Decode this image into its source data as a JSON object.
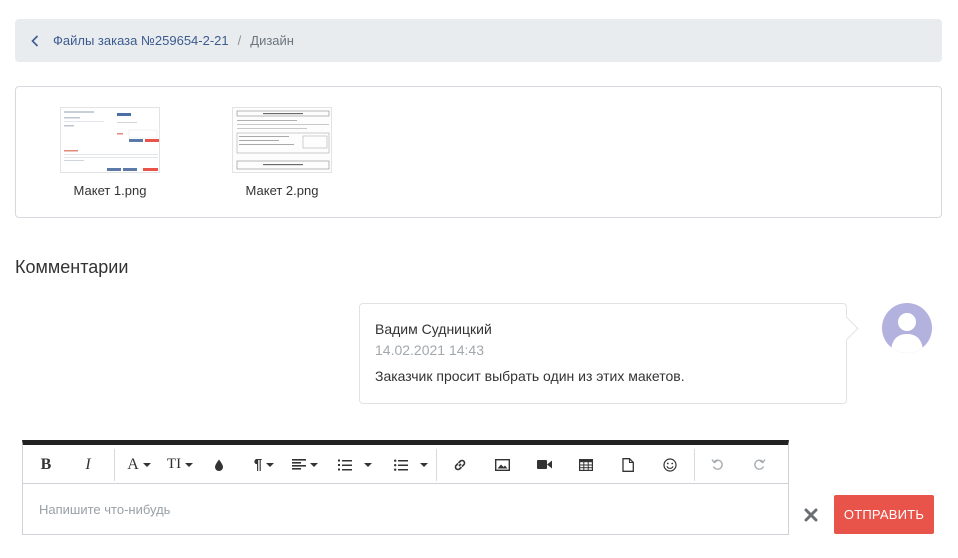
{
  "breadcrumb": {
    "back_icon": "chevron-left-icon",
    "parent_label": "Файлы заказа №259654-2-21",
    "separator": "/",
    "current_label": "Дизайн"
  },
  "files": [
    {
      "name": "Макет 1.png"
    },
    {
      "name": "Макет 2.png"
    }
  ],
  "comments_section": {
    "title": "Комментарии"
  },
  "comment": {
    "author": "Вадим Судницкий",
    "date": "14.02.2021 14:43",
    "text": "Заказчик просит выбрать один из этих макетов.",
    "avatar_icon": "user-avatar-icon"
  },
  "editor": {
    "toolbar": {
      "bold": "B",
      "italic": "I",
      "font_color": "A",
      "text_size": "TI"
    },
    "placeholder": "Напишите что-нибудь"
  },
  "actions": {
    "clear_icon": "close-icon",
    "send_label": "ОТПРАВИТЬ"
  },
  "colors": {
    "accent": "#e8534a",
    "link": "#3b5b8f",
    "breadcrumb_bg": "#e9ecef",
    "avatar_bg": "#b3b1dd"
  }
}
